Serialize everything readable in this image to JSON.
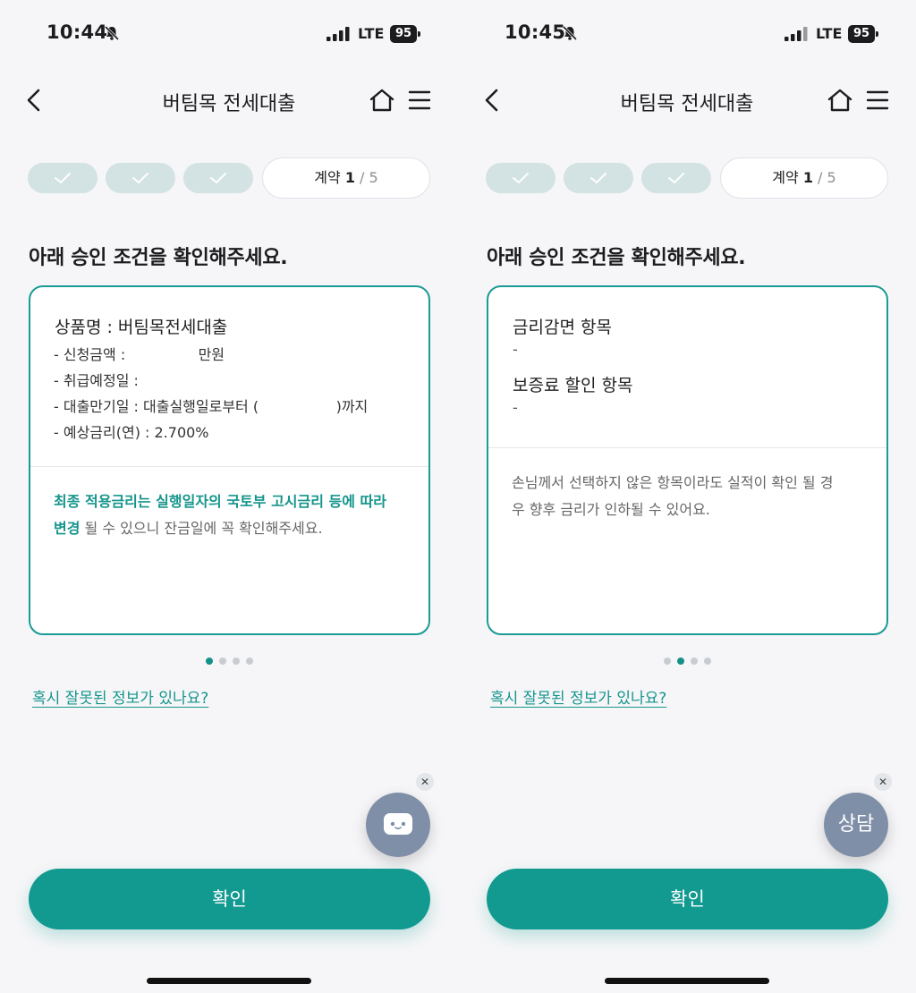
{
  "screens": [
    {
      "status": {
        "time": "10:44",
        "network": "LTE",
        "battery": "95"
      },
      "header": {
        "title": "버팀목 전세대출"
      },
      "stepper": {
        "current_label": "계약",
        "current_num": "1",
        "total": " / 5"
      },
      "heading": "아래 승인 조건을 확인해주세요.",
      "card": {
        "product_line": "상품명 : 버팀목전세대출",
        "details": [
          "- 신청금액 :                만원",
          "- 취급예정일 :",
          "- 대출만기일 : 대출실행일로부터 (                 )까지",
          "- 예상금리(연) : 2.700%"
        ],
        "note_highlight_1": "최종 적용금리는 실행일자의 국토부 고시금리 등에 따라",
        "note_highlight_2": "변경",
        "note_rest": " 될 수 있으니 잔금일에 꼭 확인해주세요."
      },
      "pagination": {
        "count": 4,
        "active": 0
      },
      "help_link": "혹시 잘못된 정보가 있나요?",
      "fab": {
        "label": "",
        "icon": "chat-bubble-icon"
      },
      "confirm_label": "확인"
    },
    {
      "status": {
        "time": "10:45",
        "network": "LTE",
        "battery": "95"
      },
      "header": {
        "title": "버팀목 전세대출"
      },
      "stepper": {
        "current_label": "계약",
        "current_num": "1",
        "total": " / 5"
      },
      "heading": "아래 승인 조건을 확인해주세요.",
      "card": {
        "section1_title": "금리감면 항목",
        "section1_value": "-",
        "section2_title": "보증료 할인 항목",
        "section2_value": "-",
        "note_1": "손님께서 선택하지 않은 항목이라도 실적이 확인 될 경",
        "note_2": "우 향후 금리가 인하될 수 있어요."
      },
      "pagination": {
        "count": 4,
        "active": 1
      },
      "help_link": "혹시 잘못된 정보가 있나요?",
      "fab": {
        "label": "상담"
      },
      "confirm_label": "확인"
    }
  ],
  "colors": {
    "accent": "#129a90",
    "step_done": "#d3e2e2",
    "fab": "#7f8fa8"
  }
}
